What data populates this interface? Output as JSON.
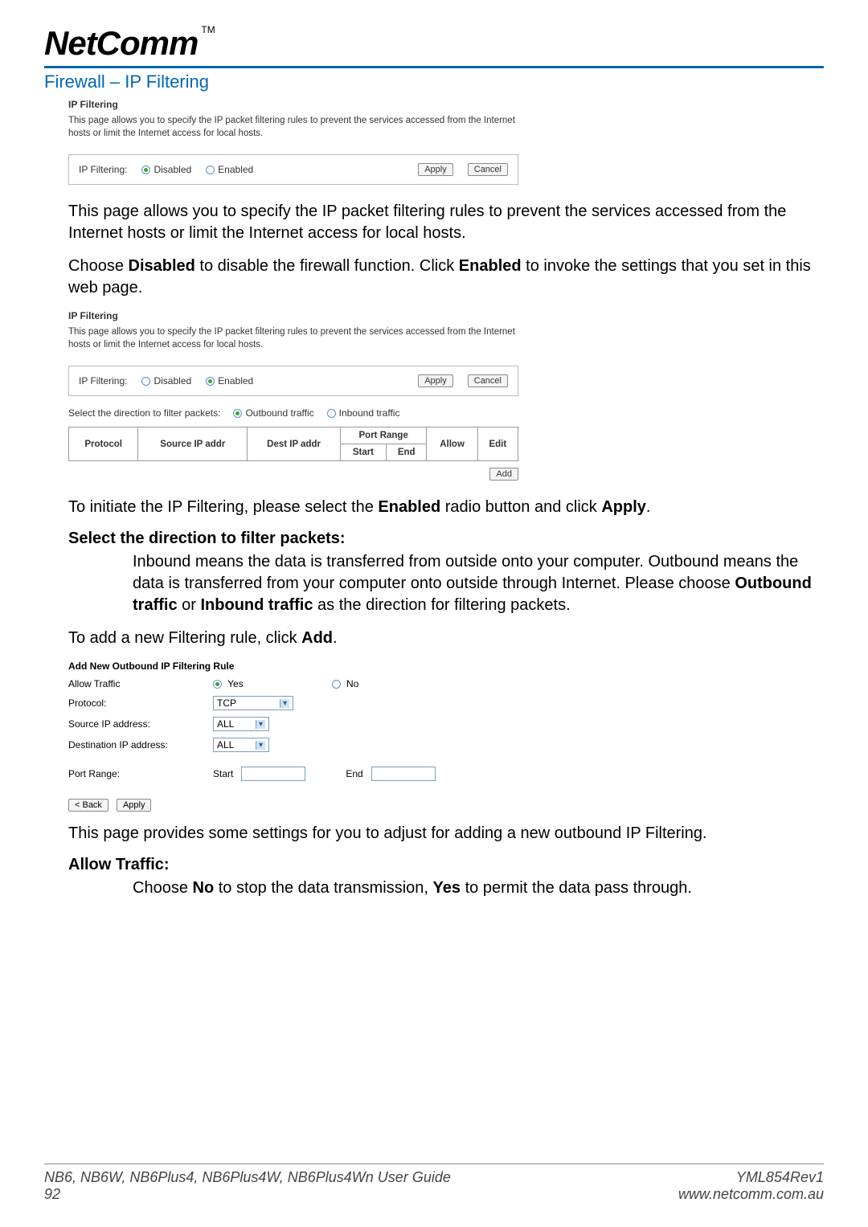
{
  "logo": {
    "text": "NetComm",
    "tm": "TM"
  },
  "section_title": "Firewall – IP Filtering",
  "ss1": {
    "heading": "IP Filtering",
    "desc": "This page allows you to specify the IP packet filtering rules to prevent the services accessed from the Internet hosts or limit the Internet access for local hosts.",
    "label": "IP Filtering:",
    "opt_disabled": "Disabled",
    "opt_enabled": "Enabled",
    "btn_apply": "Apply",
    "btn_cancel": "Cancel"
  },
  "para1": "This page allows you to specify the IP packet filtering rules to prevent the services accessed from the Internet hosts or limit the Internet access for local hosts.",
  "para2_pre": "Choose ",
  "para2_b1": "Disabled",
  "para2_mid": " to disable the firewall function. Click ",
  "para2_b2": "Enabled",
  "para2_post": " to invoke the settings that you set in this web page.",
  "ss2": {
    "heading": "IP Filtering",
    "desc": "This page allows you to specify the IP packet filtering rules to prevent the services accessed from the Internet hosts or limit the Internet access for local hosts.",
    "label": "IP Filtering:",
    "opt_disabled": "Disabled",
    "opt_enabled": "Enabled",
    "btn_apply": "Apply",
    "btn_cancel": "Cancel",
    "dir_label": "Select the direction to filter packets:",
    "dir_out": "Outbound traffic",
    "dir_in": "Inbound traffic",
    "th_protocol": "Protocol",
    "th_src": "Source IP addr",
    "th_dst": "Dest IP addr",
    "th_portrange": "Port Range",
    "th_start": "Start",
    "th_end": "End",
    "th_allow": "Allow",
    "th_edit": "Edit",
    "btn_add": "Add"
  },
  "para3_pre": "To initiate the IP Filtering, please select the ",
  "para3_b1": "Enabled",
  "para3_mid": " radio button and click ",
  "para3_b2": "Apply",
  "para3_post": ".",
  "heading_dir": "Select the direction to filter packets:",
  "para_dir_pre": "Inbound means the data is transferred from outside onto your computer. Outbound means the data is transferred from your computer onto outside through Internet. Please choose ",
  "para_dir_b1": "Outbound traffic",
  "para_dir_mid": " or ",
  "para_dir_b2": "Inbound traffic",
  "para_dir_post": " as the direction for filtering packets.",
  "para4_pre": "To add a new Filtering rule, click ",
  "para4_b": "Add",
  "para4_post": ".",
  "ss3": {
    "heading": "Add New Outbound IP Filtering Rule",
    "lbl_allow": "Allow Traffic",
    "opt_yes": "Yes",
    "opt_no": "No",
    "lbl_proto": "Protocol:",
    "val_proto": "TCP",
    "lbl_src": "Source IP address:",
    "val_src": "ALL",
    "lbl_dst": "Destination IP address:",
    "val_dst": "ALL",
    "lbl_port": "Port Range:",
    "lbl_start": "Start",
    "lbl_end": "End",
    "btn_back": "< Back",
    "btn_apply": "Apply"
  },
  "para5": "This page provides some settings for you to adjust for adding a new outbound IP Filtering.",
  "heading_allow": "Allow Traffic:",
  "para_allow_pre": "Choose ",
  "para_allow_b1": "No",
  "para_allow_mid": " to stop the data transmission, ",
  "para_allow_b2": "Yes",
  "para_allow_post": " to permit the data pass through.",
  "footer": {
    "left_line1": "NB6, NB6W, NB6Plus4, NB6Plus4W, NB6Plus4Wn User Guide",
    "left_line2": "92",
    "right_line1": "YML854Rev1",
    "right_line2": "www.netcomm.com.au"
  }
}
